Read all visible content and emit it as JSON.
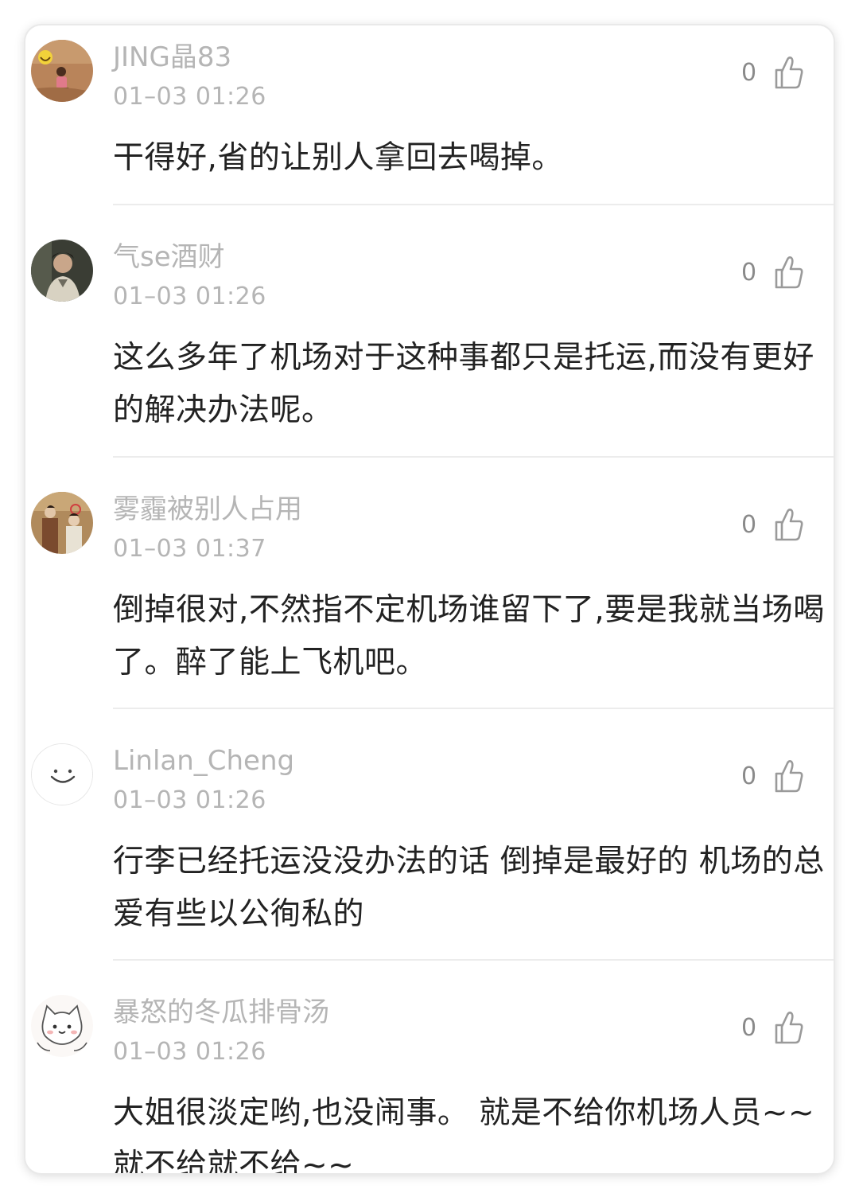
{
  "comments": [
    {
      "username": "JING晶83",
      "time": "01–03 01:26",
      "likes": "0",
      "text": "干得好,省的让别人拿回去喝掉。",
      "avatar_icon": "photo-avatar-child-desert"
    },
    {
      "username": "气se酒财",
      "time": "01–03 01:26",
      "likes": "0",
      "text": "这么多年了机场对于这种事都只是托运,而没有更好的解决办法呢。",
      "avatar_icon": "photo-avatar-man-portrait"
    },
    {
      "username": "雾霾被别人占用",
      "time": "01–03 01:37",
      "likes": "0",
      "text": "倒掉很对,不然指不定机场谁留下了,要是我就当场喝了。醉了能上飞机吧。",
      "avatar_icon": "photo-avatar-couple-drama"
    },
    {
      "username": "Linlan_Cheng",
      "time": "01–03 01:26",
      "likes": "0",
      "text": "行李已经托运没没办法的话 倒掉是最好的 机场的总爱有些以公徇私的",
      "avatar_icon": "smile-default-avatar"
    },
    {
      "username": "暴怒的冬瓜排骨汤",
      "time": "01–03 01:26",
      "likes": "0",
      "text": "大姐很淡定哟,也没闹事。 就是不给你机场人员~~就不给就不给~~",
      "avatar_icon": "cartoon-cat-avatar"
    }
  ],
  "colors": {
    "meta_text": "#b5b5b5",
    "body_text": "#222222",
    "divider": "#ececec",
    "like_icon": "#9a9a9a"
  }
}
